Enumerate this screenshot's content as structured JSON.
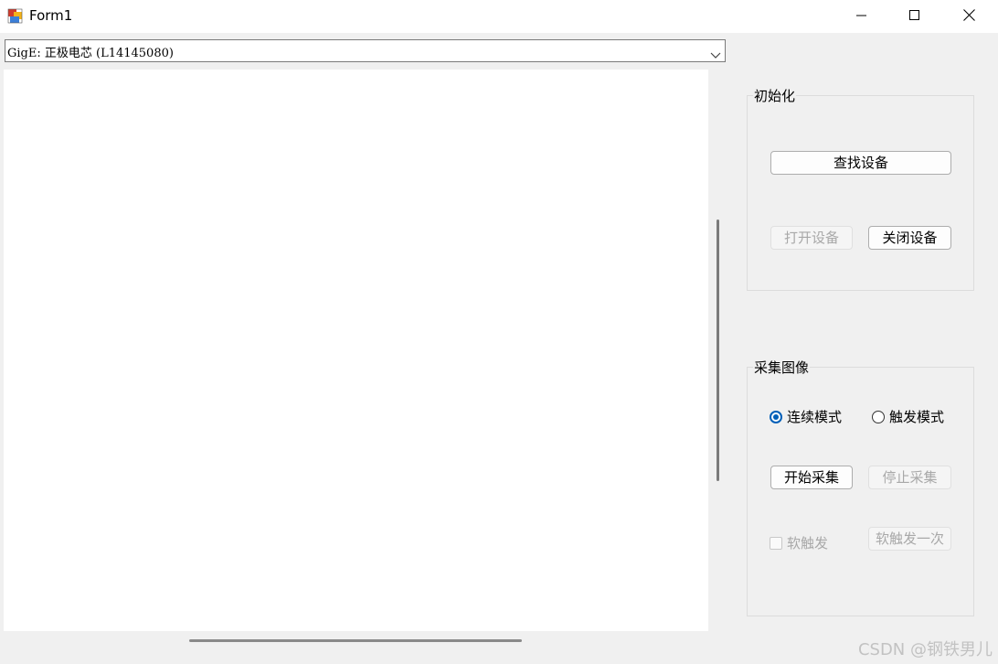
{
  "window": {
    "title": "Form1",
    "icon": "winforms-app-icon",
    "controls": [
      "minimize-icon",
      "maximize-icon",
      "close-icon"
    ]
  },
  "device_combo": {
    "selected": "GigE: 正极电芯 (L14145080)"
  },
  "init_group": {
    "title": "初始化",
    "find_device": "查找设备",
    "open_device": "打开设备",
    "close_device": "关闭设备"
  },
  "capture_group": {
    "title": "采集图像",
    "continuous_mode": "连续模式",
    "trigger_mode": "触发模式",
    "selected_mode": "continuous",
    "start_capture": "开始采集",
    "stop_capture": "停止采集",
    "soft_trigger": "软触发",
    "soft_trigger_once": "软触发一次"
  },
  "watermark": "CSDN @钢铁男儿",
  "colors": {
    "accent": "#005fb8",
    "disabled_text": "#a8a8a8",
    "window_bg": "#f0f0f0"
  }
}
